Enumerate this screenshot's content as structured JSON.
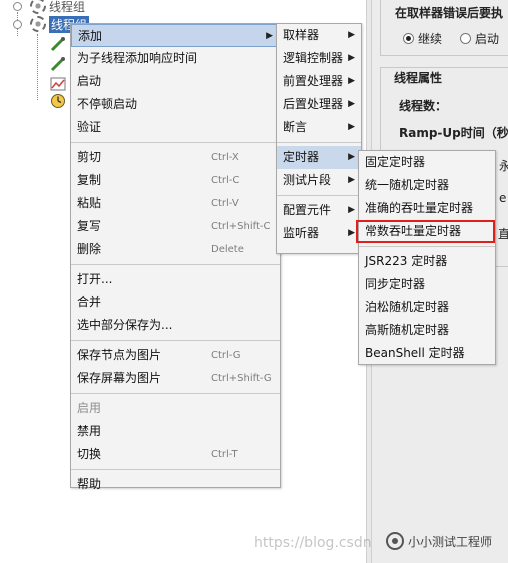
{
  "tree": {
    "node_thread_group": "线程组",
    "node_thread_group_selected": "线程组"
  },
  "right_panel": {
    "on_error_title": "在取样器错误后要执",
    "on_error_continue": "继续",
    "on_error_start_next": "启动",
    "thread_props_title": "线程属性",
    "thread_count_label": "线程数：",
    "ramp_up_label": "Ramp-Up时间（秒",
    "loop_fragment": "永",
    "fragment_e": "e",
    "fragment_zhi": "直"
  },
  "context_menu": {
    "items": [
      {
        "label": "添加",
        "shortcut": "",
        "submenu": true,
        "state": "highlighted"
      },
      {
        "label": "为子线程添加响应时间",
        "shortcut": "",
        "submenu": false,
        "state": "normal"
      },
      {
        "label": "启动",
        "shortcut": "",
        "submenu": false,
        "state": "normal"
      },
      {
        "label": "不停顿启动",
        "shortcut": "",
        "submenu": false,
        "state": "normal"
      },
      {
        "label": "验证",
        "shortcut": "",
        "submenu": false,
        "state": "normal"
      },
      {
        "label": "剪切",
        "shortcut": "Ctrl-X",
        "submenu": false,
        "state": "normal"
      },
      {
        "label": "复制",
        "shortcut": "Ctrl-C",
        "submenu": false,
        "state": "normal"
      },
      {
        "label": "粘贴",
        "shortcut": "Ctrl-V",
        "submenu": false,
        "state": "normal"
      },
      {
        "label": "复写",
        "shortcut": "Ctrl+Shift-C",
        "submenu": false,
        "state": "normal"
      },
      {
        "label": "删除",
        "shortcut": "Delete",
        "submenu": false,
        "state": "normal"
      },
      {
        "label": "打开...",
        "shortcut": "",
        "submenu": false,
        "state": "normal"
      },
      {
        "label": "合并",
        "shortcut": "",
        "submenu": false,
        "state": "normal"
      },
      {
        "label": "选中部分保存为...",
        "shortcut": "",
        "submenu": false,
        "state": "normal"
      },
      {
        "label": "保存节点为图片",
        "shortcut": "Ctrl-G",
        "submenu": false,
        "state": "normal"
      },
      {
        "label": "保存屏幕为图片",
        "shortcut": "Ctrl+Shift-G",
        "submenu": false,
        "state": "normal"
      },
      {
        "label": "启用",
        "shortcut": "",
        "submenu": false,
        "state": "disabled"
      },
      {
        "label": "禁用",
        "shortcut": "",
        "submenu": false,
        "state": "normal"
      },
      {
        "label": "切换",
        "shortcut": "Ctrl-T",
        "submenu": false,
        "state": "normal"
      },
      {
        "label": "帮助",
        "shortcut": "",
        "submenu": false,
        "state": "normal"
      }
    ]
  },
  "add_submenu": {
    "items": [
      {
        "label": "取样器",
        "submenu": true,
        "state": "normal"
      },
      {
        "label": "逻辑控制器",
        "submenu": true,
        "state": "normal"
      },
      {
        "label": "前置处理器",
        "submenu": true,
        "state": "normal"
      },
      {
        "label": "后置处理器",
        "submenu": true,
        "state": "normal"
      },
      {
        "label": "断言",
        "submenu": true,
        "state": "normal"
      },
      {
        "label": "定时器",
        "submenu": true,
        "state": "highlighted"
      },
      {
        "label": "测试片段",
        "submenu": true,
        "state": "normal"
      },
      {
        "label": "配置元件",
        "submenu": true,
        "state": "normal"
      },
      {
        "label": "监听器",
        "submenu": true,
        "state": "normal"
      }
    ]
  },
  "timer_submenu": {
    "items": [
      {
        "label": "固定定时器",
        "state": "normal"
      },
      {
        "label": "统一随机定时器",
        "state": "normal"
      },
      {
        "label": "准确的吞吐量定时器",
        "state": "normal"
      },
      {
        "label": "常数吞吐量定时器",
        "state": "highlighted"
      },
      {
        "label": "JSR223 定时器",
        "state": "normal"
      },
      {
        "label": "同步定时器",
        "state": "normal"
      },
      {
        "label": "泊松随机定时器",
        "state": "normal"
      },
      {
        "label": "高斯随机定时器",
        "state": "normal"
      },
      {
        "label": "BeanShell 定时器",
        "state": "normal"
      }
    ]
  },
  "watermark": {
    "url": "https://blog.csdn",
    "brand": "小小测试工程师"
  },
  "colors": {
    "highlight_border": "#e0211b",
    "selected_node": "#3a6fb6",
    "menu_background": "#f3f3f3"
  }
}
